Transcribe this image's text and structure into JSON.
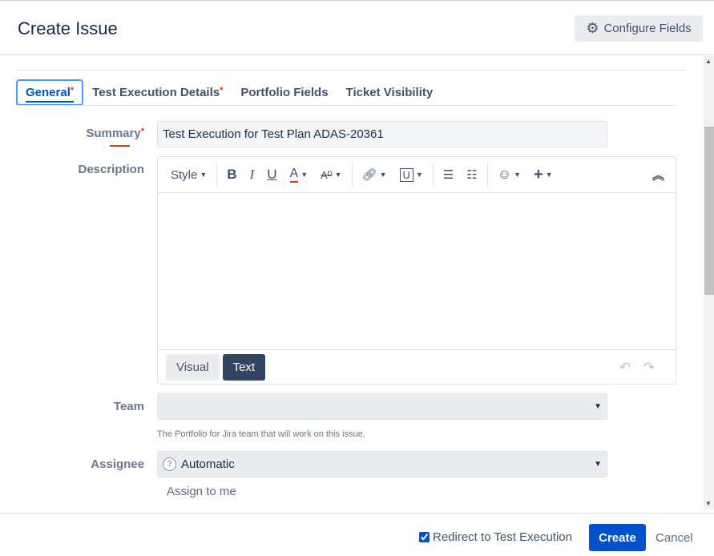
{
  "header": {
    "title": "Create Issue",
    "configure_fields": "Configure Fields"
  },
  "tabs": [
    {
      "label": "General",
      "required": "*"
    },
    {
      "label": "Test Execution Details",
      "required": "*"
    },
    {
      "label": "Portfolio Fields"
    },
    {
      "label": "Ticket Visibility"
    }
  ],
  "summary": {
    "label": "Summary",
    "required": "*",
    "value": "Test Execution for Test Plan ADAS-20361"
  },
  "description": {
    "label": "Description",
    "style_label": "Style",
    "modes": [
      "Visual",
      "Text"
    ],
    "active_mode": "Text"
  },
  "team": {
    "label": "Team",
    "value": "",
    "help": "The Portfolio for Jira team that will work on this issue."
  },
  "assignee": {
    "label": "Assignee",
    "value": "Automatic",
    "assign_to_me": "Assign to me"
  },
  "footer": {
    "redirect_label": "Redirect to Test Execution",
    "redirect_checked": true,
    "create": "Create",
    "cancel": "Cancel"
  }
}
